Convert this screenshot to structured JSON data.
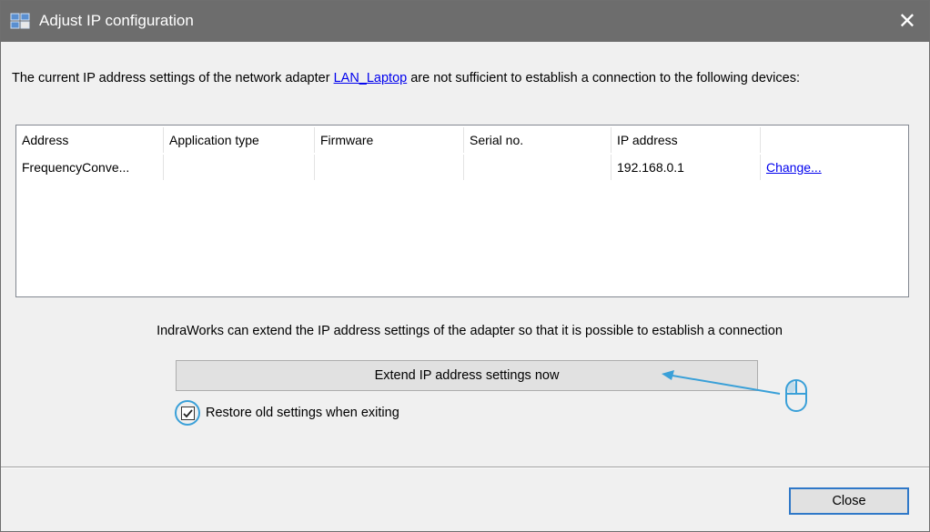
{
  "window": {
    "title": "Adjust IP configuration",
    "close_glyph": "✕",
    "icon": "network-app-icon"
  },
  "intro": {
    "text_before": "The current IP address settings of the network adapter ",
    "adapter_link": "LAN_Laptop",
    "text_after": " are not sufficient to establish a connection to the following devices:"
  },
  "device_table": {
    "columns": [
      "Address",
      "Application type",
      "Firmware",
      "Serial no.",
      "IP address",
      ""
    ],
    "rows": [
      {
        "address": "FrequencyConve...",
        "application_type": "",
        "firmware": "",
        "serial_no": "",
        "ip_address": "192.168.0.1",
        "action": "Change..."
      }
    ]
  },
  "hint": "IndraWorks can extend the IP address settings of the adapter so that it is possible to establish a connection",
  "extend_button": "Extend IP address settings now",
  "restore_checkbox": {
    "label": "Restore old settings when exiting",
    "checked": true
  },
  "close_button": "Close",
  "colors": {
    "titlebar": "#6d6d6d",
    "link": "#0000ee",
    "highlight": "#3aa0d8",
    "focus_border": "#2f78c8"
  }
}
